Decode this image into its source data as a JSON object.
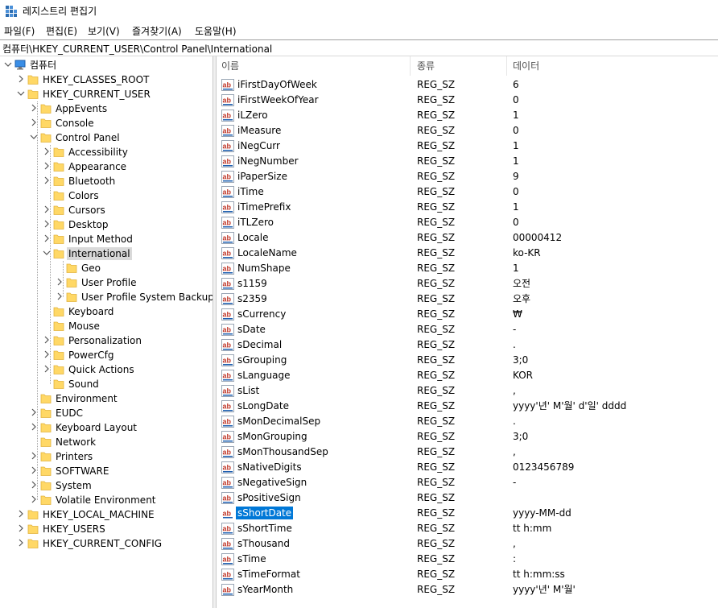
{
  "window": {
    "title": "레지스트리 편집기"
  },
  "menu": [
    {
      "label": "파일(F)"
    },
    {
      "label": "편집(E)"
    },
    {
      "label": "보기(V)"
    },
    {
      "label": "즐겨찾기(A)"
    },
    {
      "label": "도움말(H)"
    }
  ],
  "address": "컴퓨터\\HKEY_CURRENT_USER\\Control Panel\\International",
  "tree": [
    {
      "label": "컴퓨터",
      "icon": "computer-icon",
      "expander": "expanded"
    },
    {
      "label": "HKEY_CLASSES_ROOT",
      "expander": "collapsed"
    },
    {
      "label": "HKEY_CURRENT_USER",
      "expander": "expanded"
    },
    {
      "label": "AppEvents",
      "expander": "collapsed"
    },
    {
      "label": "Console",
      "expander": "collapsed"
    },
    {
      "label": "Control Panel",
      "expander": "expanded"
    },
    {
      "label": "Accessibility",
      "expander": "collapsed"
    },
    {
      "label": "Appearance",
      "expander": "collapsed"
    },
    {
      "label": "Bluetooth",
      "expander": "collapsed"
    },
    {
      "label": "Colors",
      "expander": "none"
    },
    {
      "label": "Cursors",
      "expander": "collapsed"
    },
    {
      "label": "Desktop",
      "expander": "collapsed"
    },
    {
      "label": "Input Method",
      "expander": "collapsed"
    },
    {
      "label": "International",
      "expander": "expanded",
      "selected": true
    },
    {
      "label": "Geo",
      "expander": "none"
    },
    {
      "label": "User Profile",
      "expander": "collapsed"
    },
    {
      "label": "User Profile System Backup",
      "expander": "collapsed"
    },
    {
      "label": "Keyboard",
      "expander": "none"
    },
    {
      "label": "Mouse",
      "expander": "none"
    },
    {
      "label": "Personalization",
      "expander": "collapsed"
    },
    {
      "label": "PowerCfg",
      "expander": "collapsed"
    },
    {
      "label": "Quick Actions",
      "expander": "collapsed"
    },
    {
      "label": "Sound",
      "expander": "none"
    },
    {
      "label": "Environment",
      "expander": "none"
    },
    {
      "label": "EUDC",
      "expander": "collapsed"
    },
    {
      "label": "Keyboard Layout",
      "expander": "collapsed"
    },
    {
      "label": "Network",
      "expander": "none"
    },
    {
      "label": "Printers",
      "expander": "collapsed"
    },
    {
      "label": "SOFTWARE",
      "expander": "collapsed"
    },
    {
      "label": "System",
      "expander": "collapsed"
    },
    {
      "label": "Volatile Environment",
      "expander": "collapsed"
    },
    {
      "label": "HKEY_LOCAL_MACHINE",
      "expander": "collapsed"
    },
    {
      "label": "HKEY_USERS",
      "expander": "collapsed"
    },
    {
      "label": "HKEY_CURRENT_CONFIG",
      "expander": "collapsed"
    }
  ],
  "list": {
    "columns": [
      "이름",
      "종류",
      "데이터"
    ],
    "rows": [
      {
        "name": "iFirstDayOfWeek",
        "type": "REG_SZ",
        "data": "6"
      },
      {
        "name": "iFirstWeekOfYear",
        "type": "REG_SZ",
        "data": "0"
      },
      {
        "name": "iLZero",
        "type": "REG_SZ",
        "data": "1"
      },
      {
        "name": "iMeasure",
        "type": "REG_SZ",
        "data": "0"
      },
      {
        "name": "iNegCurr",
        "type": "REG_SZ",
        "data": "1"
      },
      {
        "name": "iNegNumber",
        "type": "REG_SZ",
        "data": "1"
      },
      {
        "name": "iPaperSize",
        "type": "REG_SZ",
        "data": "9"
      },
      {
        "name": "iTime",
        "type": "REG_SZ",
        "data": "0"
      },
      {
        "name": "iTimePrefix",
        "type": "REG_SZ",
        "data": "1"
      },
      {
        "name": "iTLZero",
        "type": "REG_SZ",
        "data": "0"
      },
      {
        "name": "Locale",
        "type": "REG_SZ",
        "data": "00000412"
      },
      {
        "name": "LocaleName",
        "type": "REG_SZ",
        "data": "ko-KR"
      },
      {
        "name": "NumShape",
        "type": "REG_SZ",
        "data": "1"
      },
      {
        "name": "s1159",
        "type": "REG_SZ",
        "data": "오전"
      },
      {
        "name": "s2359",
        "type": "REG_SZ",
        "data": "오후"
      },
      {
        "name": "sCurrency",
        "type": "REG_SZ",
        "data": "₩"
      },
      {
        "name": "sDate",
        "type": "REG_SZ",
        "data": "-"
      },
      {
        "name": "sDecimal",
        "type": "REG_SZ",
        "data": "."
      },
      {
        "name": "sGrouping",
        "type": "REG_SZ",
        "data": "3;0"
      },
      {
        "name": "sLanguage",
        "type": "REG_SZ",
        "data": "KOR"
      },
      {
        "name": "sList",
        "type": "REG_SZ",
        "data": ","
      },
      {
        "name": "sLongDate",
        "type": "REG_SZ",
        "data": "yyyy'년' M'월' d'일' dddd"
      },
      {
        "name": "sMonDecimalSep",
        "type": "REG_SZ",
        "data": "."
      },
      {
        "name": "sMonGrouping",
        "type": "REG_SZ",
        "data": "3;0"
      },
      {
        "name": "sMonThousandSep",
        "type": "REG_SZ",
        "data": ","
      },
      {
        "name": "sNativeDigits",
        "type": "REG_SZ",
        "data": "0123456789"
      },
      {
        "name": "sNegativeSign",
        "type": "REG_SZ",
        "data": "-"
      },
      {
        "name": "sPositiveSign",
        "type": "REG_SZ",
        "data": ""
      },
      {
        "name": "sShortDate",
        "type": "REG_SZ",
        "data": "yyyy-MM-dd",
        "selected": true
      },
      {
        "name": "sShortTime",
        "type": "REG_SZ",
        "data": "tt h:mm"
      },
      {
        "name": "sThousand",
        "type": "REG_SZ",
        "data": ","
      },
      {
        "name": "sTime",
        "type": "REG_SZ",
        "data": ":"
      },
      {
        "name": "sTimeFormat",
        "type": "REG_SZ",
        "data": "tt h:mm:ss"
      },
      {
        "name": "sYearMonth",
        "type": "REG_SZ",
        "data": "yyyy'년' M'월'"
      }
    ]
  },
  "colors": {
    "selection": "#0078d7",
    "tree_selection": "#d9d9d9",
    "folder": "#ffd866",
    "folder_edge": "#e2b33c",
    "ab_red": "#c0392b",
    "ab_blue": "#1d5fb0"
  }
}
